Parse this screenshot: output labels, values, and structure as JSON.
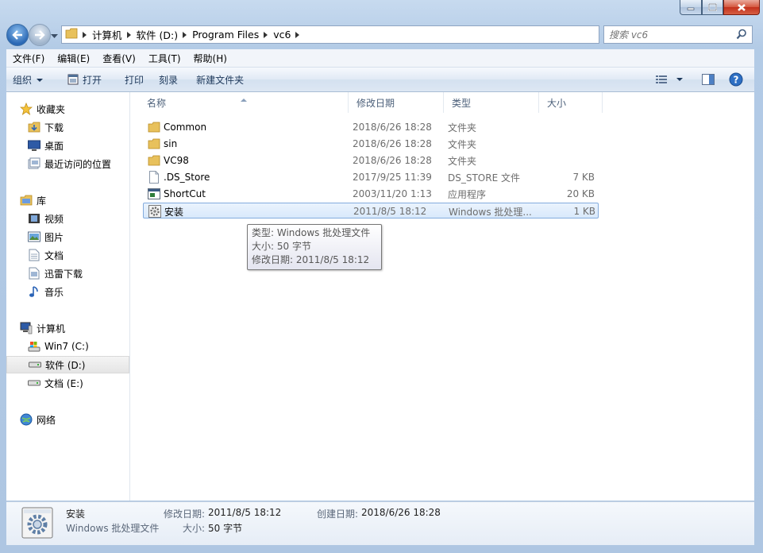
{
  "breadcrumb": [
    "计算机",
    "软件 (D:)",
    "Program Files",
    "vc6"
  ],
  "search": {
    "placeholder": "搜索 vc6"
  },
  "menu": [
    "文件(F)",
    "编辑(E)",
    "查看(V)",
    "工具(T)",
    "帮助(H)"
  ],
  "toolbar": {
    "organize": "组织",
    "open": "打开",
    "print": "打印",
    "burn": "刻录",
    "new_folder": "新建文件夹"
  },
  "nav": {
    "favorites": "收藏夹",
    "favorites_items": [
      "下载",
      "桌面",
      "最近访问的位置"
    ],
    "libraries": "库",
    "libraries_items": [
      "视频",
      "图片",
      "文档",
      "迅雷下载",
      "音乐"
    ],
    "computer": "计算机",
    "computer_items": [
      "Win7 (C:)",
      "软件 (D:)",
      "文档 (E:)"
    ],
    "network": "网络"
  },
  "columns": {
    "name": "名称",
    "date": "修改日期",
    "type": "类型",
    "size": "大小"
  },
  "files": [
    {
      "name": "Common",
      "date": "2018/6/26 18:28",
      "type": "文件夹",
      "size": "",
      "icon": "folder-icon"
    },
    {
      "name": "sin",
      "date": "2018/6/26 18:28",
      "type": "文件夹",
      "size": "",
      "icon": "folder-icon"
    },
    {
      "name": "VC98",
      "date": "2018/6/26 18:28",
      "type": "文件夹",
      "size": "",
      "icon": "folder-icon"
    },
    {
      "name": ".DS_Store",
      "date": "2017/9/25 11:39",
      "type": "DS_STORE 文件",
      "size": "7 KB",
      "icon": "file-icon"
    },
    {
      "name": "ShortCut",
      "date": "2003/11/20 1:13",
      "type": "应用程序",
      "size": "20 KB",
      "icon": "exe-icon"
    },
    {
      "name": "安装",
      "date": "2011/8/5 18:12",
      "type": "Windows 批处理...",
      "size": "1 KB",
      "icon": "batch-gear-icon"
    }
  ],
  "tooltip": {
    "line1": "类型: Windows 批处理文件",
    "line2": "大小: 50 字节",
    "line3": "修改日期: 2011/8/5 18:12"
  },
  "details": {
    "name": "安装",
    "type": "Windows 批处理文件",
    "modified_label": "修改日期:",
    "modified": "2011/8/5 18:12",
    "size_label": "大小:",
    "size": "50 字节",
    "created_label": "创建日期:",
    "created": "2018/6/26 18:28"
  }
}
